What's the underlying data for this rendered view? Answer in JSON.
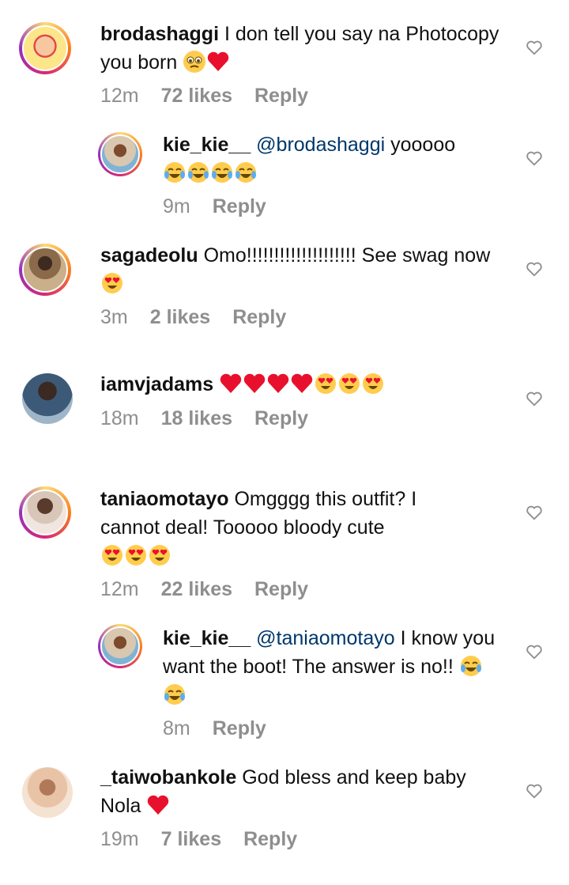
{
  "comments": [
    {
      "username": "brodashaggi",
      "text": "I don tell you say na Photocopy you born",
      "emoji": [
        "crying-face",
        "red-heart"
      ],
      "time": "12m",
      "likes": "72 likes",
      "reply": "Reply"
    },
    {
      "username": "kie_kie__",
      "mention": "@brodashaggi",
      "text": "yooooo",
      "emoji": [
        "tears-of-joy",
        "tears-of-joy",
        "tears-of-joy",
        "tears-of-joy"
      ],
      "time": "9m",
      "reply": "Reply"
    },
    {
      "username": "sagadeolu",
      "text": "Omo!!!!!!!!!!!!!!!!!!!! See swag now",
      "emoji": [
        "heart-eyes"
      ],
      "time": "3m",
      "likes": "2 likes",
      "reply": "Reply"
    },
    {
      "username": "iamvjadams",
      "text": "",
      "emoji": [
        "red-heart",
        "red-heart",
        "red-heart",
        "red-heart",
        "heart-eyes",
        "heart-eyes",
        "heart-eyes"
      ],
      "time": "18m",
      "likes": "18 likes",
      "reply": "Reply"
    },
    {
      "username": "taniaomotayo",
      "text": "Omgggg this outfit? I cannot deal! Tooooo bloody cute",
      "emoji": [
        "heart-eyes",
        "heart-eyes",
        "heart-eyes"
      ],
      "time": "12m",
      "likes": "22 likes",
      "reply": "Reply"
    },
    {
      "username": "kie_kie__",
      "mention": "@taniaomotayo",
      "text": "I know you want the boot! The answer is no!!",
      "emoji": [
        "tears-of-joy",
        "tears-of-joy"
      ],
      "time": "8m",
      "reply": "Reply"
    },
    {
      "username": "_taiwobankole",
      "text": "God bless and keep baby Nola",
      "emoji": [
        "red-heart"
      ],
      "time": "19m",
      "likes": "7 likes",
      "reply": "Reply"
    }
  ],
  "colors": {
    "username": "#111111",
    "meta": "#8e8e8e",
    "mention": "#00376b"
  },
  "icons": {
    "like": "heart-outline-icon"
  }
}
